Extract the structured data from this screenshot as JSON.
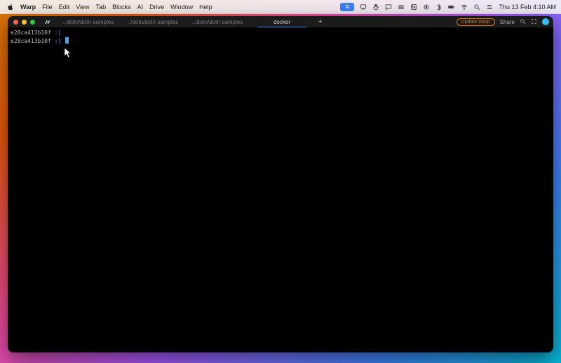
{
  "menubar": {
    "app_name": "Warp",
    "items": [
      "File",
      "Edit",
      "View",
      "Tab",
      "Blocks",
      "AI",
      "Drive",
      "Window",
      "Help"
    ],
    "clock": "Thu 13 Feb  4:10 AM"
  },
  "window": {
    "tabs": [
      {
        "label": "../dotn/dotn-samples",
        "active": false
      },
      {
        "label": "../dotn/dotn-samples",
        "active": false
      },
      {
        "label": "../dotn/dotn-samples",
        "active": false
      },
      {
        "label": "docker",
        "active": true
      }
    ],
    "sub_indicator": "•",
    "toolbar": {
      "update_label": "Update Warp",
      "share_label": "Share"
    }
  },
  "terminal": {
    "lines": [
      {
        "host": "e28ca413b10f",
        "sep": ":",
        "sym": ")"
      },
      {
        "host": "e28ca413b10f",
        "sep": ":",
        "sym": ")"
      }
    ]
  }
}
